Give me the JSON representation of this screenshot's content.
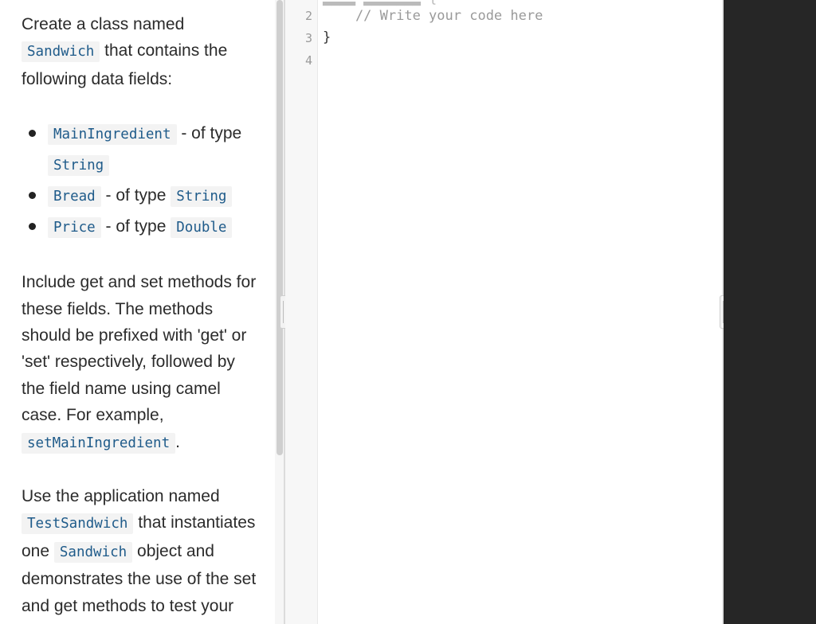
{
  "instructions": {
    "p1_a": "Create a class named",
    "p1_code": "Sandwich",
    "p1_b": "that contains the following data fields:",
    "fields": [
      {
        "name": "MainIngredient",
        "sep": "- of type",
        "type": "String"
      },
      {
        "name": "Bread",
        "sep": "- of type",
        "type": "String"
      },
      {
        "name": "Price",
        "sep": "- of type",
        "type": "Double"
      }
    ],
    "p2_a": "Include get and set methods for these fields. The methods should be prefixed with 'get' or 'set' respectively, followed by the field name using camel case. For example,",
    "p2_code": "setMainIngredient",
    "p2_end": ".",
    "p3_a": "Use the application named",
    "p3_code1": "TestSandwich",
    "p3_b": "that instantiates one",
    "p3_code2": "Sandwich",
    "p3_c": "object and demonstrates the use of the set and get methods to test your class."
  },
  "editor": {
    "lines": [
      {
        "number": "2",
        "text": "    // Write your code here",
        "type": "comment"
      },
      {
        "number": "3",
        "text": "}",
        "type": "code"
      },
      {
        "number": "4",
        "text": "",
        "type": "code"
      }
    ]
  }
}
